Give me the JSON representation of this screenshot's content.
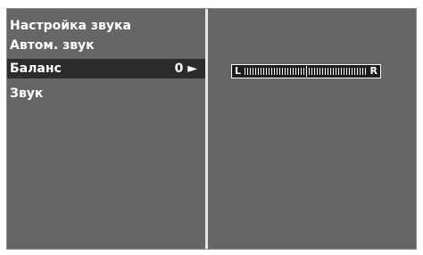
{
  "menu": {
    "title": "Настройка звука",
    "items": [
      {
        "label": "Автом. звук"
      },
      {
        "label": "Баланс",
        "value": "0",
        "arrow": "►"
      },
      {
        "label": "Звук"
      }
    ]
  },
  "balance": {
    "left_label": "L",
    "right_label": "R",
    "level": 0
  }
}
